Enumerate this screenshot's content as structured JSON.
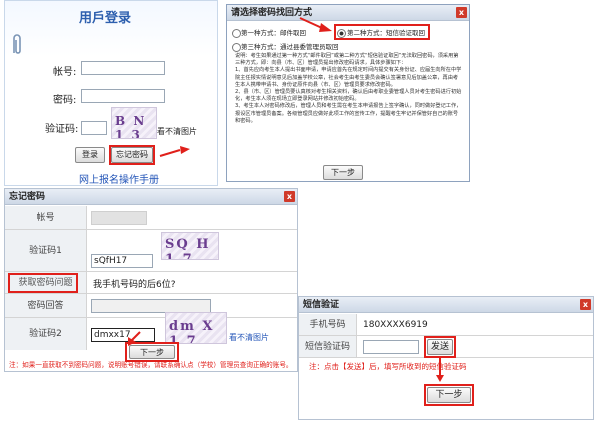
{
  "login": {
    "title": "用戶登录",
    "account_label": "帐号:",
    "password_label": "密码:",
    "captcha_label": "验证码:",
    "captcha_text": "B N 1 3",
    "cant_see": "看不清图片",
    "login_button": "登录",
    "forgot_button": "忘记密码",
    "footer_link": "网上报名操作手册"
  },
  "dialog": {
    "title": "请选择密码找回方式",
    "close": "x",
    "option1": "第一种方式：邮件取回",
    "option2": "第二种方式：短信验证取回",
    "option3": "第三种方式：通过县委管理员取回",
    "paragraphs": [
      "说明：考生如果通过第一种方式“邮件取回”或第二种方式“短信验证取回”无法取回密码，须采用第三种方式，即：向县（市、区）管理员提出修改密码请求，具体步骤如下：",
      "1、首先应向考生本人提出书面申请，申请应首先在规定时间内提交有关身份证、应届生向所在中学院主任报实情说明意见后加盖学校公章，社会考生由考生委员会确认签署意见后加盖公章，再由考生本人携带申请书、身份证原件向县（市、区）管理员要求修改密码。",
      "2、县（市、区）管理员要认真核对考生相关资料，确认后由考职业委管理人员对考生密码进行初始化，考生本人须在现场立即登录网站并修改初始密码。",
      "3、考生本人对密码修改后，管理人员和考生需在考生本申请报告上签字确认，同时做好登记工作，报设区市管理员备案。各级管理员应做好此项工作的宣传工作，提醒考生牢记并保管好自己的账号和密码。"
    ],
    "next": "下一步"
  },
  "forgot": {
    "title": "忘记密码",
    "account_label": "帐号",
    "account_value": "",
    "captcha1_label": "验证码1",
    "captcha1_value": "sQfH17",
    "captcha1_text": "SQ H 1 7",
    "question_label": "获取密码问题",
    "question_value": "我手机号码的后6位?",
    "answer_label": "密码回答",
    "captcha2_label": "验证码2",
    "captcha2_value": "dmxx17",
    "captcha2_text": "dm X 1 7",
    "cant_see": "看不清图片",
    "next": "下一步",
    "note": "注：如果一直获取不到密码问题，说明账号错误，请联系确认点（学校）管理员查询正确的账号。"
  },
  "sms": {
    "title": "短信验证",
    "phone_label": "手机号码",
    "phone_value": "180XXXX6919",
    "code_label": "短信验证码",
    "code_value": "",
    "send_button": "发送",
    "note": "注：点击【发送】后，填写所收到的短信验证码",
    "next": "下一步"
  },
  "colors": {
    "accent_red": "#e0201b",
    "title_blue": "#2d5fae",
    "link_blue": "#2456b8"
  }
}
